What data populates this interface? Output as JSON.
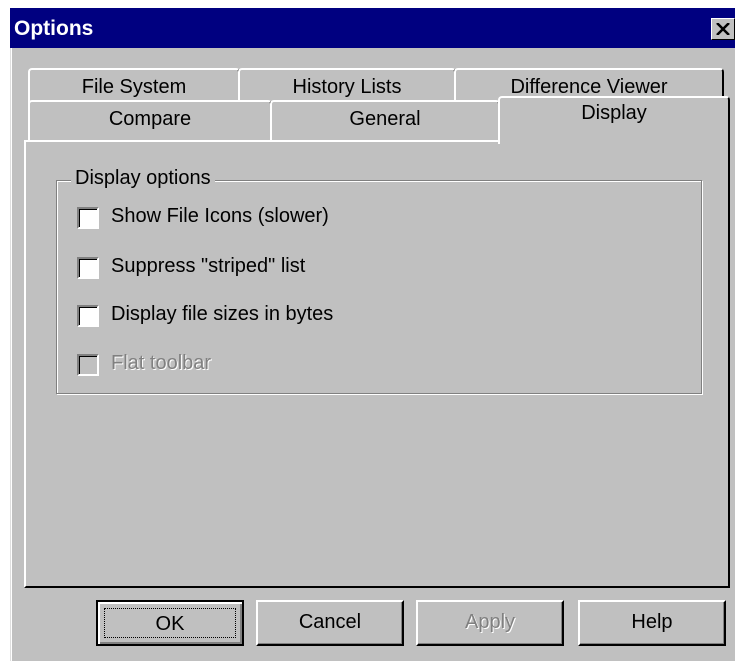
{
  "window": {
    "title": "Options",
    "close_label": "×"
  },
  "tabs": {
    "back_row": [
      "File System",
      "History Lists",
      "Difference Viewer"
    ],
    "front_row": [
      "Compare",
      "General",
      "Display"
    ],
    "selected": "Display"
  },
  "display_options": {
    "group_label": "Display options",
    "checkboxes": [
      {
        "label": "Show File Icons (slower)",
        "checked": false,
        "enabled": true
      },
      {
        "label": "Suppress \"striped\" list",
        "checked": false,
        "enabled": true
      },
      {
        "label": "Display file sizes in bytes",
        "checked": false,
        "enabled": true
      },
      {
        "label": "Flat toolbar",
        "checked": false,
        "enabled": false
      }
    ]
  },
  "buttons": {
    "ok": "OK",
    "cancel": "Cancel",
    "apply": "Apply",
    "help": "Help"
  },
  "colors": {
    "face": "#c0c0c0",
    "titlebar": "#000080",
    "disabled_text": "#808080"
  }
}
